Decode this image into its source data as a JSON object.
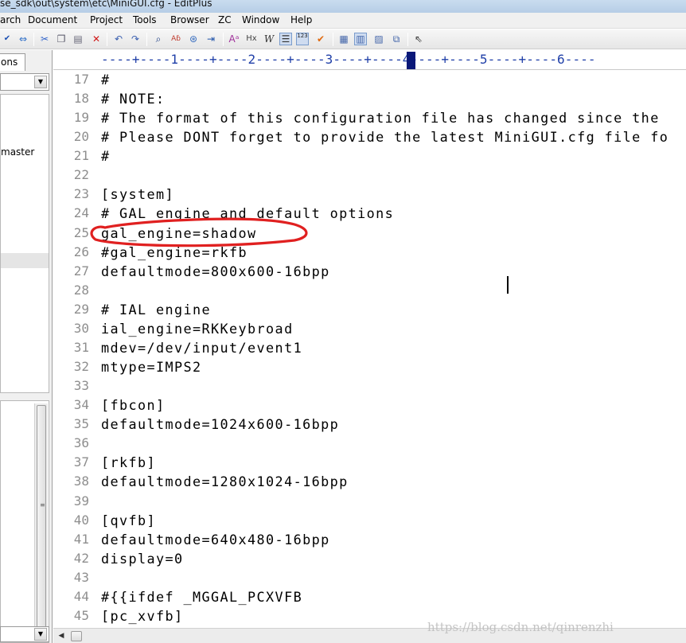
{
  "window": {
    "title": "se_sdk\\out\\system\\etc\\MiniGUI.cfg - EditPlus"
  },
  "menu": [
    {
      "label": "arch"
    },
    {
      "label": "Document"
    },
    {
      "label": "Project"
    },
    {
      "label": "Tools"
    },
    {
      "label": "Browser"
    },
    {
      "label": "ZC"
    },
    {
      "label": "Window"
    },
    {
      "label": "Help"
    }
  ],
  "toolbar": {
    "icons": [
      "spellcheck-icon",
      "cut-icon",
      "copy-icon",
      "paste-icon",
      "delete-icon",
      "undo-icon",
      "redo-icon",
      "find-icon",
      "replace-icon",
      "goto-icon",
      "font-icon",
      "hex-icon",
      "word-wrap-icon",
      "ruler-icon",
      "line-number-icon",
      "check-icon",
      "browser-icon",
      "split-icon",
      "preview-icon",
      "view-icon",
      "help-cursor-icon"
    ],
    "line_number_label": "123"
  },
  "left_pane": {
    "tab_label": "tions",
    "list_item": "master"
  },
  "ruler": {
    "text": "----+----1----+----2----+----3----+----4----+----5----+----6----"
  },
  "editor": {
    "colors": {
      "line_number": "#8e8e8e",
      "ruler": "#1f3fa8",
      "annotation": "#e02020"
    },
    "lines": [
      {
        "num": "17",
        "text": "#"
      },
      {
        "num": "18",
        "text": "# NOTE:"
      },
      {
        "num": "19",
        "text": "# The format of this configuration file has changed since the"
      },
      {
        "num": "20",
        "text": "# Please DONT forget to provide the latest MiniGUI.cfg file fo"
      },
      {
        "num": "21",
        "text": "#"
      },
      {
        "num": "22",
        "text": ""
      },
      {
        "num": "23",
        "text": "[system]"
      },
      {
        "num": "24",
        "text": "# GAL engine and default options"
      },
      {
        "num": "25",
        "text": "gal_engine=shadow"
      },
      {
        "num": "26",
        "text": "#gal_engine=rkfb"
      },
      {
        "num": "27",
        "text": "defaultmode=800x600-16bpp"
      },
      {
        "num": "28",
        "text": ""
      },
      {
        "num": "29",
        "text": "# IAL engine"
      },
      {
        "num": "30",
        "text": "ial_engine=RKKeybroad"
      },
      {
        "num": "31",
        "text": "mdev=/dev/input/event1"
      },
      {
        "num": "32",
        "text": "mtype=IMPS2"
      },
      {
        "num": "33",
        "text": ""
      },
      {
        "num": "34",
        "text": "[fbcon]"
      },
      {
        "num": "35",
        "text": "defaultmode=1024x600-16bpp"
      },
      {
        "num": "36",
        "text": ""
      },
      {
        "num": "37",
        "text": "[rkfb]"
      },
      {
        "num": "38",
        "text": "defaultmode=1280x1024-16bpp"
      },
      {
        "num": "39",
        "text": ""
      },
      {
        "num": "40",
        "text": "[qvfb]"
      },
      {
        "num": "41",
        "text": "defaultmode=640x480-16bpp"
      },
      {
        "num": "42",
        "text": "display=0"
      },
      {
        "num": "43",
        "text": ""
      },
      {
        "num": "44",
        "text": "#{{ifdef _MGGAL_PCXVFB"
      },
      {
        "num": "45",
        "text": "[pc_xvfb]"
      }
    ]
  },
  "watermark": "https://blog.csdn.net/qinrenzhi"
}
